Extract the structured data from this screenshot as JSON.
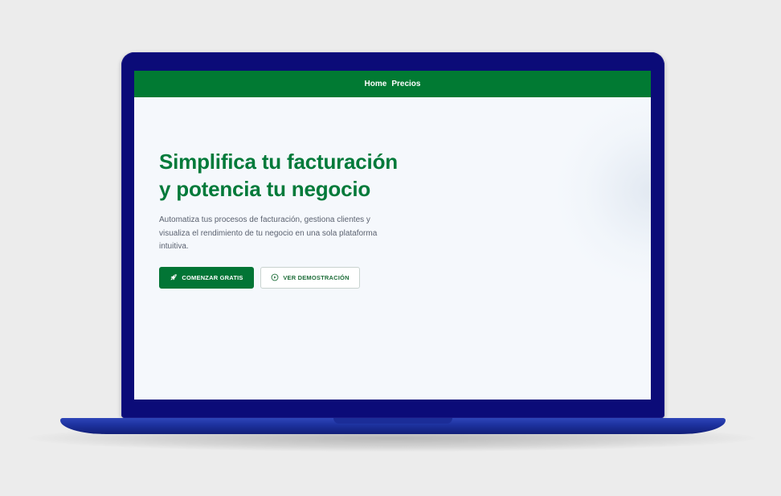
{
  "nav": {
    "items": [
      {
        "label": "Home"
      },
      {
        "label": "Precios"
      }
    ]
  },
  "hero": {
    "title": "Simplifica tu facturación y potencia tu negocio",
    "description": "Automatiza tus procesos de facturación, gestiona clientes y visualiza el rendimiento de tu negocio en una sola plataforma intuitiva.",
    "primary_button": {
      "label": "COMENZAR GRATIS",
      "icon": "rocket-icon"
    },
    "secondary_button": {
      "label": "VER DEMOSTRACIÓN",
      "icon": "play-circle-icon"
    }
  },
  "colors": {
    "brand_green": "#017a33",
    "laptop_body": "#0b0b78",
    "screen_bg": "#f5f8fc"
  }
}
